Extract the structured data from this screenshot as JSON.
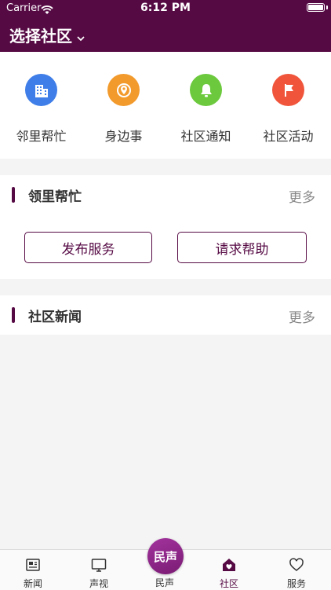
{
  "status": {
    "carrier": "Carrier",
    "time": "6:12 PM"
  },
  "header": {
    "community_select": "选择社区"
  },
  "quick_actions": [
    {
      "label": "邻里帮忙",
      "icon": "building-icon",
      "color": "#3f7ee8"
    },
    {
      "label": "身边事",
      "icon": "location-pin-icon",
      "color": "#f29a2c"
    },
    {
      "label": "社区通知",
      "icon": "bell-icon",
      "color": "#6cc93d"
    },
    {
      "label": "社区活动",
      "icon": "flag-icon",
      "color": "#f0553b"
    }
  ],
  "neighbor_help": {
    "title": "领里帮忙",
    "more": "更多",
    "publish_button": "发布服务",
    "request_button": "请求帮助"
  },
  "news": {
    "title": "社区新闻",
    "more": "更多"
  },
  "tabs": [
    {
      "label": "新闻",
      "icon": "newspaper-icon"
    },
    {
      "label": "声视",
      "icon": "tv-icon"
    },
    {
      "label": "民声",
      "icon": "minsheng-icon",
      "badge": "民声"
    },
    {
      "label": "社区",
      "icon": "home-icon",
      "active": true
    },
    {
      "label": "服务",
      "icon": "heart-icon"
    }
  ],
  "colors": {
    "brand": "#560a44",
    "accent": "#8e2a8b"
  }
}
